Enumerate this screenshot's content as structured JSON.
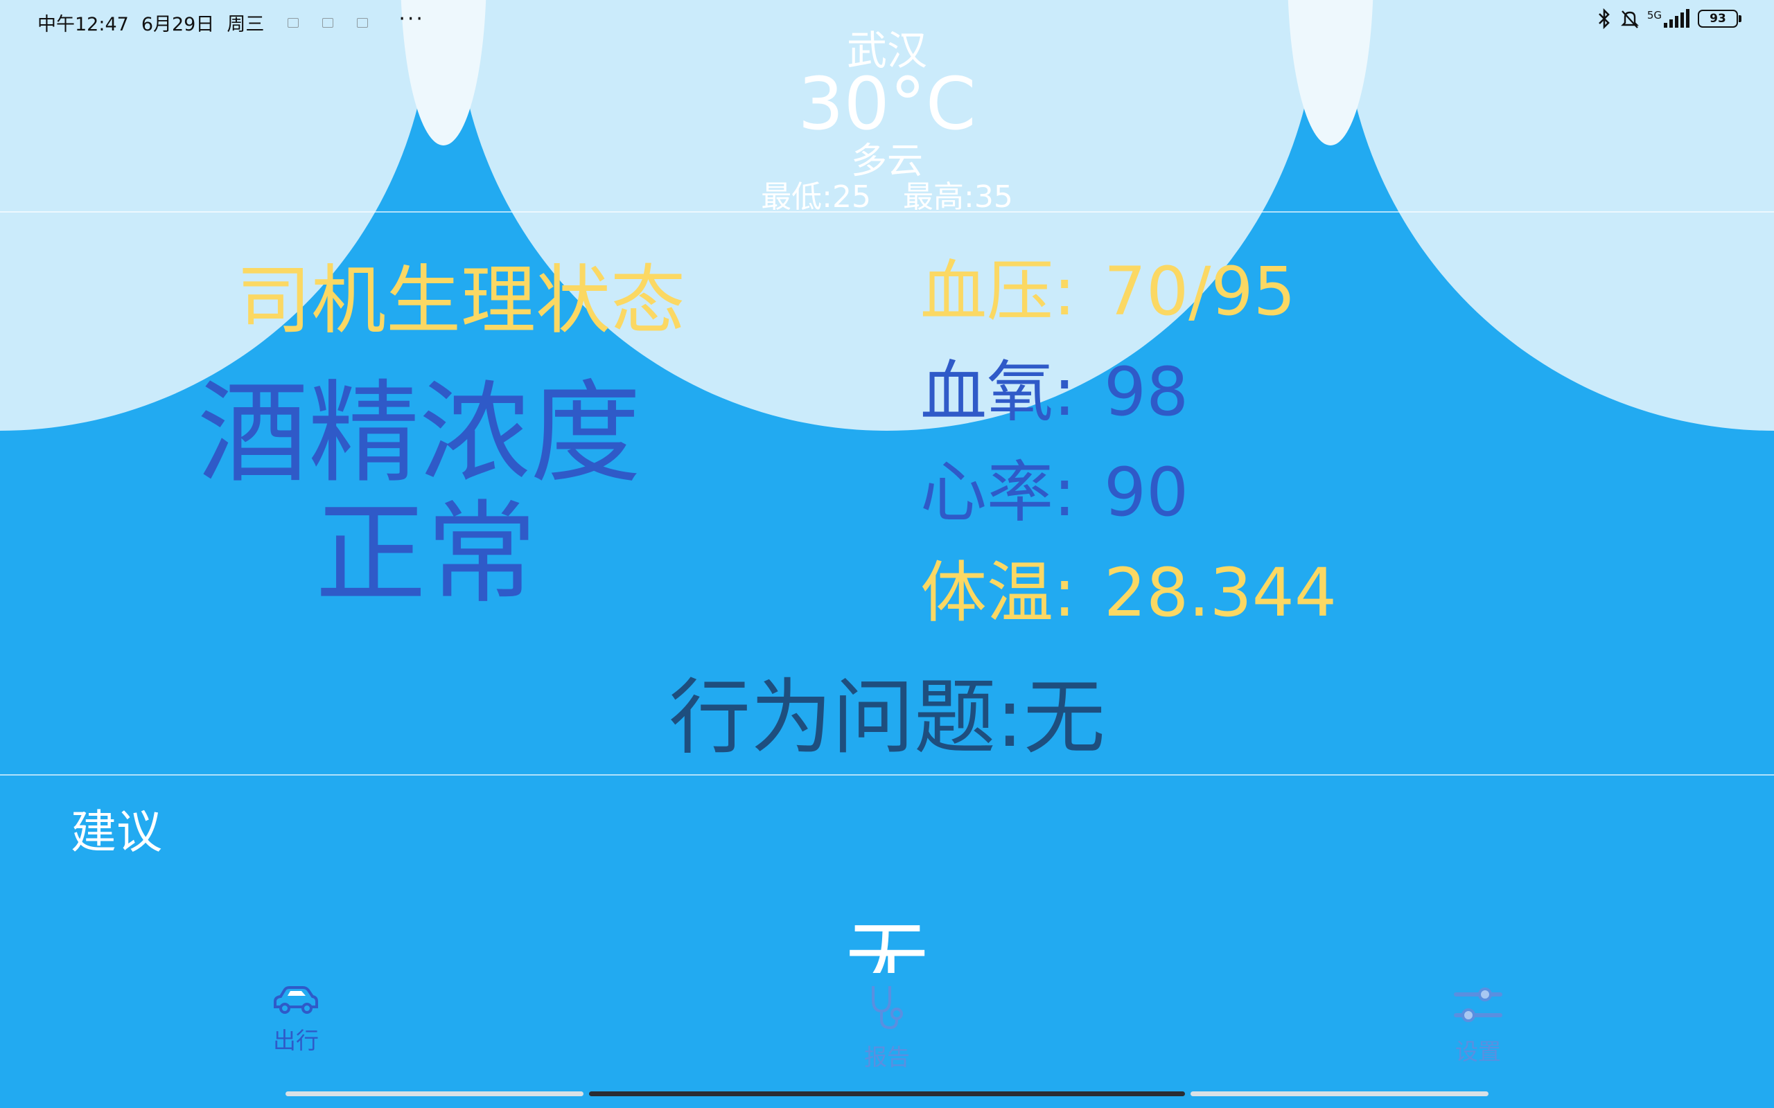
{
  "status_bar": {
    "time": "中午12:47",
    "date": "6月29日",
    "weekday": "周三",
    "more": "···",
    "network": "5G",
    "battery": "93"
  },
  "weather": {
    "city": "武汉",
    "temperature": "30°C",
    "condition": "多云",
    "low": "最低:25",
    "high": "最高:35"
  },
  "driver": {
    "section_title": "司机生理状态",
    "alcohol_label": "酒精浓度",
    "alcohol_value": "正常",
    "vitals": [
      {
        "label": "血压:",
        "value": "70/95",
        "color": "#fbd863"
      },
      {
        "label": "血氧:",
        "value": "98",
        "color": "#2f5ac8"
      },
      {
        "label": "心率:",
        "value": "90",
        "color": "#2f5ac8"
      },
      {
        "label": "体温:",
        "value": "28.344",
        "color": "#fbd863"
      }
    ],
    "behavior": "行为问题:无"
  },
  "advice": {
    "label": "建议",
    "value": "无"
  },
  "nav": {
    "items": [
      {
        "label": "出行",
        "icon": "car-icon"
      },
      {
        "label": "报告",
        "icon": "stethoscope-icon"
      },
      {
        "label": "设置",
        "icon": "sliders-icon"
      }
    ]
  },
  "colors": {
    "background": "#22aaf1",
    "light_circle": "#cbebfb",
    "highlight": "#fbd863",
    "value_blue": "#2f5ac8",
    "behavior": "#1e4e7e"
  }
}
